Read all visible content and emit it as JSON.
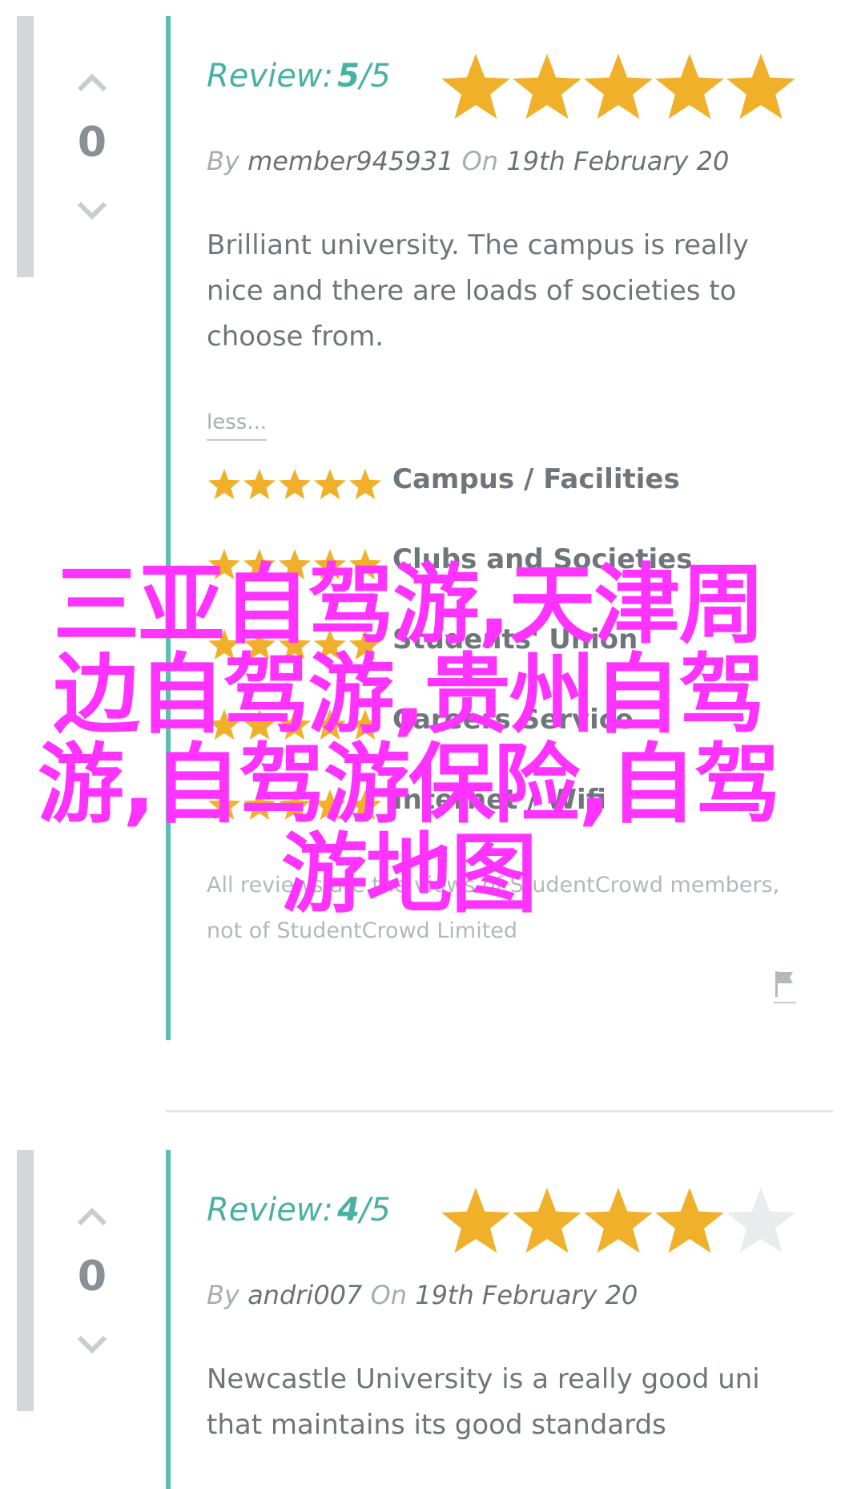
{
  "colors": {
    "accent": "#5cbdb1",
    "star_filled": "#f0b02a",
    "star_empty": "#e9ebec",
    "overlay_text": "#ff33ff"
  },
  "reviews": [
    {
      "vote_count": "0",
      "review_label": "Review:",
      "score": "5",
      "score_max": "/5",
      "rating": 5,
      "by_label": "By",
      "author": "member945931",
      "on_label": "On",
      "date": "19th February 20",
      "text": "Brilliant university. The campus is really nice and there are loads of societies to choose from.",
      "less_label": "less...",
      "categories": [
        {
          "label": "Campus / Facilities",
          "rating": 5
        },
        {
          "label": "Clubs and Societies",
          "rating": 5
        },
        {
          "label": "Students' Union",
          "rating": 5
        },
        {
          "label": "Careers Service",
          "rating": 5
        },
        {
          "label": "Internet / Wifi",
          "rating": 5
        }
      ],
      "disclaimer": "All reviews are the views of StudentCrowd members, not of StudentCrowd Limited"
    },
    {
      "vote_count": "0",
      "review_label": "Review:",
      "score": "4",
      "score_max": "/5",
      "rating": 4,
      "by_label": "By",
      "author": "andri007",
      "on_label": "On",
      "date": "19th February 20",
      "text": "Newcastle University is a really good uni that maintains its good standards"
    }
  ],
  "overlay": {
    "text": "三亚自驾游,天津周边自驾游,贵州自驾游,自驾游保险,自驾游地图"
  }
}
